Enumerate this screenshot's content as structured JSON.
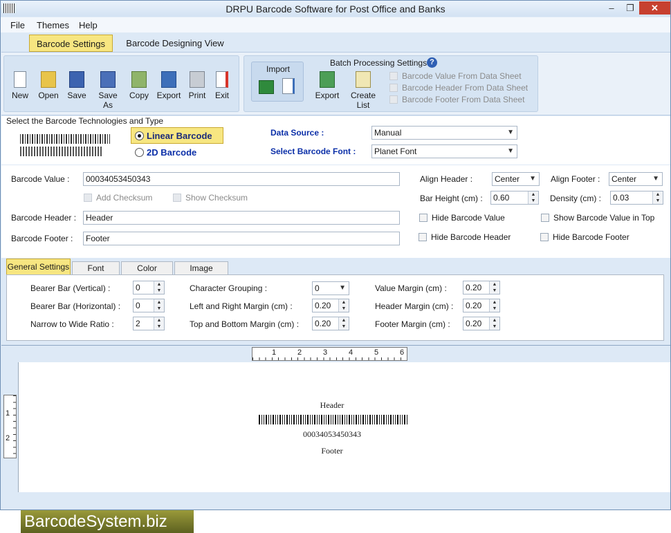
{
  "window": {
    "title": "DRPU Barcode Software for Post Office and Banks",
    "controls": [
      "–",
      "❐",
      "✕"
    ]
  },
  "menu": [
    "File",
    "Themes",
    "Help"
  ],
  "top_tabs": [
    "Barcode Settings",
    "Barcode Designing View"
  ],
  "toolbar": {
    "buttons": [
      "New",
      "Open",
      "Save",
      "Save As",
      "Copy",
      "Export",
      "Print",
      "Exit"
    ],
    "import_title": "Import",
    "batch_title": "Batch Processing Settings",
    "batch_export": "Export",
    "batch_create_list": "Create List",
    "batch_options": [
      "Barcode Value From Data Sheet",
      "Barcode Header From Data Sheet",
      "Barcode Footer From Data Sheet"
    ]
  },
  "tech": {
    "section_label": "Select the Barcode Technologies and Type",
    "linear": "Linear Barcode",
    "twod": "2D Barcode",
    "data_source_label": "Data Source :",
    "data_source_value": "Manual",
    "font_label": "Select Barcode Font :",
    "font_value": "Planet Font"
  },
  "form": {
    "barcode_value_label": "Barcode Value :",
    "barcode_value": "00034053450343",
    "add_checksum": "Add Checksum",
    "show_checksum": "Show Checksum",
    "header_label": "Barcode Header :",
    "header_value": "Header",
    "footer_label": "Barcode Footer :",
    "footer_value": "Footer",
    "align_header_label": "Align Header  :",
    "align_header_value": "Center",
    "align_footer_label": "Align Footer :",
    "align_footer_value": "Center",
    "bar_height_label": "Bar Height (cm) :",
    "bar_height_value": "0.60",
    "density_label": "Density (cm) :",
    "density_value": "0.03",
    "hide_value": "Hide Barcode Value",
    "show_value_top": "Show Barcode Value in Top",
    "hide_header": "Hide Barcode Header",
    "hide_footer": "Hide Barcode Footer"
  },
  "subtabs": [
    "General Settings",
    "Font Settings",
    "Color Settings",
    "Image Settings"
  ],
  "general": {
    "bearer_v_label": "Bearer Bar (Vertical) :",
    "bearer_v": "0",
    "bearer_h_label": "Bearer Bar (Horizontal) :",
    "bearer_h": "0",
    "narrow_label": "Narrow to Wide Ratio :",
    "narrow": "2",
    "char_group_label": "Character Grouping   :",
    "char_group": "0",
    "lr_margin_label": "Left and Right Margin (cm) :",
    "lr_margin": "0.20",
    "tb_margin_label": "Top and Bottom Margin (cm) :",
    "tb_margin": "0.20",
    "value_margin_label": "Value Margin (cm) :",
    "value_margin": "0.20",
    "header_margin_label": "Header Margin (cm) :",
    "header_margin": "0.20",
    "footer_margin_label": "Footer Margin (cm) :",
    "footer_margin": "0.20"
  },
  "preview": {
    "ruler_h": [
      "1",
      "2",
      "3",
      "4",
      "5",
      "6"
    ],
    "ruler_v": [
      "1",
      "2"
    ],
    "header": "Header",
    "value": "00034053450343",
    "footer": "Footer"
  },
  "brand": "BarcodeSystem.biz"
}
